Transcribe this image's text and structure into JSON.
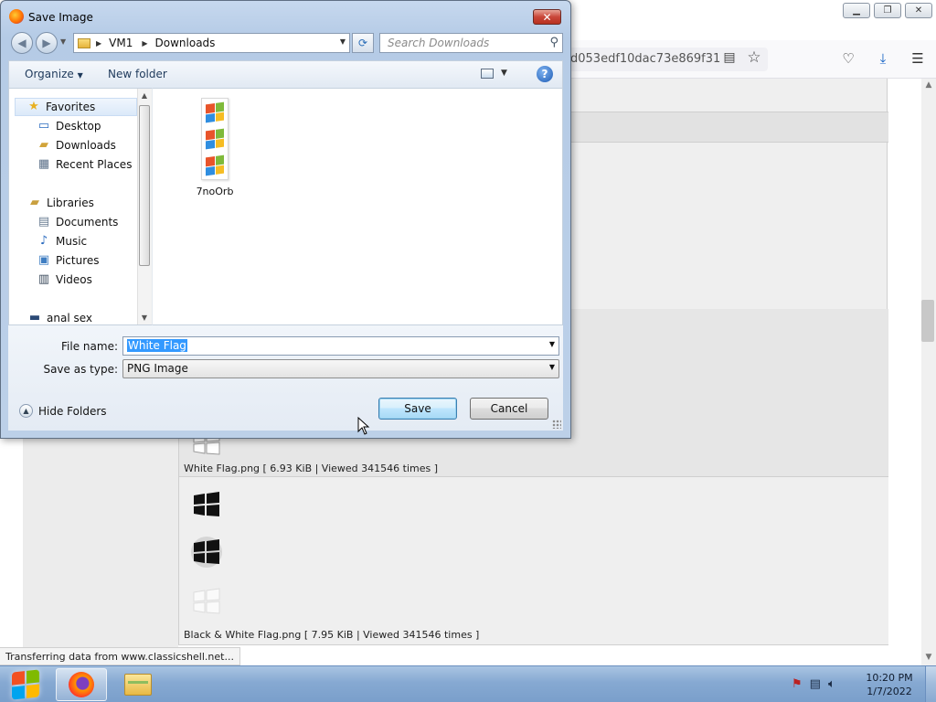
{
  "browser": {
    "url_fragment": "d053edf10dac73e869f31",
    "reader_icon": "reader-view-icon",
    "bookmark_icon": "star-icon",
    "toolbar_icons": [
      "pocket-icon",
      "download-icon",
      "menu-icon"
    ],
    "window_controls": [
      "minimize",
      "maximize",
      "close"
    ],
    "status_text": "Transferring data from www.classicshell.net..."
  },
  "page": {
    "items": [
      {
        "caption": "White Flag.png [ 6.93 KiB | Viewed 341546 times ]"
      },
      {
        "caption": "Black & White Flag.png [ 7.95 KiB | Viewed 341546 times ]"
      }
    ]
  },
  "dialog": {
    "title": "Save Image",
    "breadcrumb": [
      "VM1",
      "Downloads"
    ],
    "search_placeholder": "Search Downloads",
    "organize_label": "Organize",
    "new_folder_label": "New folder",
    "help_label": "?",
    "nav": {
      "favorites": "Favorites",
      "desktop": "Desktop",
      "downloads": "Downloads",
      "recent_places": "Recent Places",
      "libraries": "Libraries",
      "documents": "Documents",
      "music": "Music",
      "pictures": "Pictures",
      "videos": "Videos",
      "computer": "anal sex"
    },
    "files": [
      {
        "name": "7noOrb"
      }
    ],
    "file_name_label": "File name:",
    "file_name_value": "White Flag",
    "save_type_label": "Save as type:",
    "save_type_value": "PNG Image",
    "hide_folders_label": "Hide Folders",
    "save_label": "Save",
    "cancel_label": "Cancel"
  },
  "taskbar": {
    "time": "10:20 PM",
    "date": "1/7/2022",
    "pinned": [
      "firefox",
      "windows-explorer"
    ]
  }
}
